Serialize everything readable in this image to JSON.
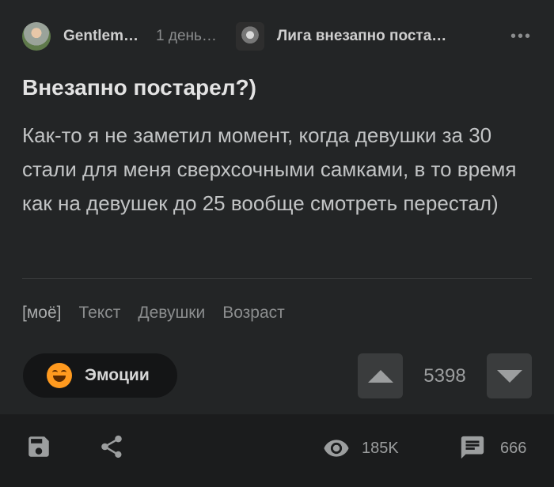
{
  "header": {
    "author": "Gentlem…",
    "time": "1 день…",
    "community": "Лига внезапно поста…",
    "more_label": "•••"
  },
  "post": {
    "title": "Внезапно постарел?)",
    "body": "Как-то я не заметил момент, когда девушки за 30 стали для меня сверхсочными самками, в то время как на девушек до 25 вообще смотреть перестал)",
    "tags": [
      "[моё]",
      "Текст",
      "Девушки",
      "Возраст"
    ]
  },
  "actions": {
    "emotions_label": "Эмоции",
    "rating": "5398"
  },
  "footer": {
    "views": "185K",
    "comments": "666"
  },
  "icons": [
    "avatar",
    "community-icon",
    "more-icon",
    "smile-emoji-icon",
    "arrow-up-icon",
    "arrow-down-icon",
    "save-icon",
    "share-icon",
    "eye-icon",
    "comment-icon"
  ],
  "colors": {
    "background": "#232526",
    "footer": "#1b1c1d",
    "vote_button": "#3a3c3d",
    "text_primary": "#e3e3e3",
    "text_secondary": "#8b8d8e",
    "emoji": "#ff9a1f"
  }
}
